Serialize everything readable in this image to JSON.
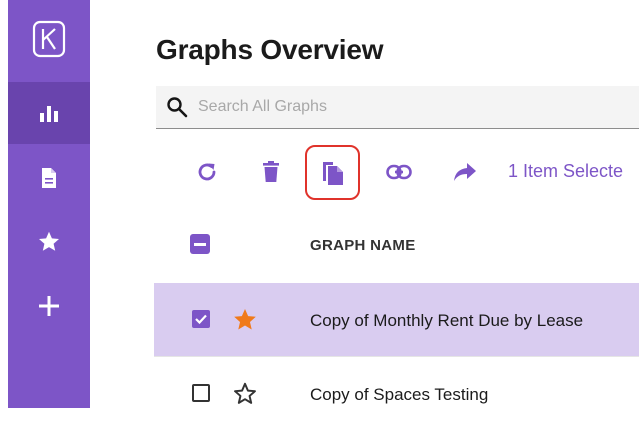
{
  "sidebar": {
    "logo": "logo-icon",
    "items": [
      {
        "icon": "bar-chart-icon",
        "active": true
      },
      {
        "icon": "document-icon",
        "active": false
      },
      {
        "icon": "star-icon",
        "active": false
      },
      {
        "icon": "plus-icon",
        "active": false
      }
    ]
  },
  "page": {
    "title": "Graphs Overview"
  },
  "search": {
    "placeholder": "Search All Graphs",
    "value": ""
  },
  "toolbar": {
    "icons": [
      "refresh-icon",
      "trash-icon",
      "copy-icon",
      "link-icon",
      "share-icon"
    ],
    "selected_count": "1 Item Selecte"
  },
  "table": {
    "column_header": "GRAPH NAME",
    "header_checkbox": "indeterminate",
    "rows": [
      {
        "name": "Copy of Monthly Rent Due by Lease",
        "checked": true,
        "starred": true
      },
      {
        "name": "Copy of Spaces Testing",
        "checked": false,
        "starred": false
      }
    ]
  },
  "colors": {
    "accent": "#7d55c7",
    "sidebar_active": "#6944ad",
    "selected_row": "#d9ccf0",
    "star_filled": "#f07a1a",
    "highlight": "#e0332b"
  }
}
